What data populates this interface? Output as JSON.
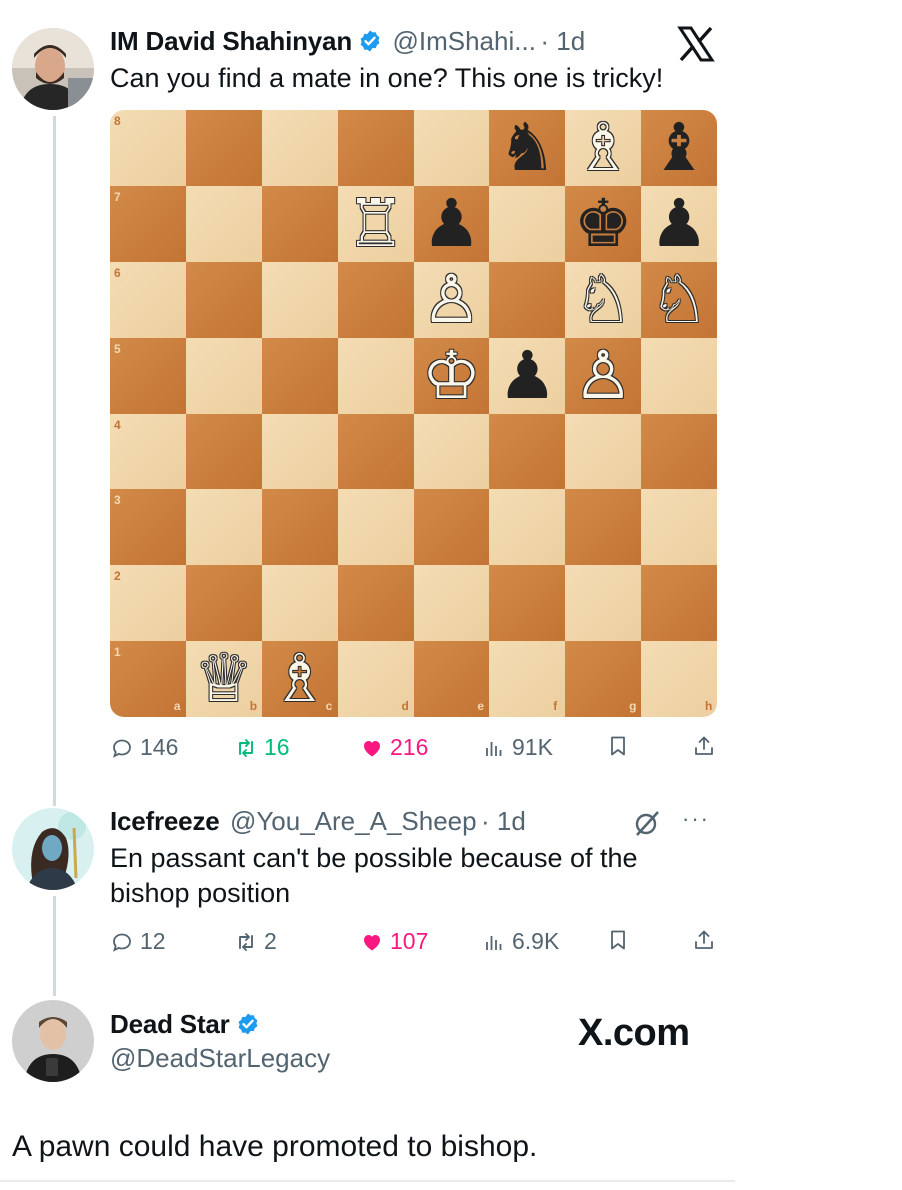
{
  "tweet1": {
    "name": "IM David Shahinyan",
    "handle": "@ImShahi...",
    "time": "· 1d",
    "text": "Can you find a mate in one? This one is tricky!",
    "replies": "146",
    "retweets": "16",
    "likes": "216",
    "views": "91K"
  },
  "board": {
    "ranks": [
      "8",
      "7",
      "6",
      "5",
      "4",
      "3",
      "2",
      "1"
    ],
    "files": [
      "a",
      "b",
      "c",
      "d",
      "e",
      "f",
      "g",
      "h"
    ],
    "pieces": [
      {
        "square": "f8",
        "glyph": "♞",
        "color": "black"
      },
      {
        "square": "g8",
        "glyph": "♗",
        "color": "white"
      },
      {
        "square": "h8",
        "glyph": "♝",
        "color": "black"
      },
      {
        "square": "d7",
        "glyph": "♖",
        "color": "white"
      },
      {
        "square": "e7",
        "glyph": "♟",
        "color": "black"
      },
      {
        "square": "g7",
        "glyph": "♚",
        "color": "black"
      },
      {
        "square": "h7",
        "glyph": "♟",
        "color": "black"
      },
      {
        "square": "e6",
        "glyph": "♙",
        "color": "white"
      },
      {
        "square": "g6",
        "glyph": "♘",
        "color": "white"
      },
      {
        "square": "h6",
        "glyph": "♘",
        "color": "white"
      },
      {
        "square": "e5",
        "glyph": "♔",
        "color": "white"
      },
      {
        "square": "f5",
        "glyph": "♟",
        "color": "black"
      },
      {
        "square": "g5",
        "glyph": "♙",
        "color": "white"
      },
      {
        "square": "b1",
        "glyph": "♕",
        "color": "white"
      },
      {
        "square": "c1",
        "glyph": "♗",
        "color": "white"
      }
    ],
    "colors": {
      "light": "#f0d9b5",
      "dark": "#c87a3c"
    }
  },
  "tweet2": {
    "name": "Icefreeze",
    "handle": "@You_Are_A_Sheep",
    "time": "· 1d",
    "text_line1": "En passant can't be possible because of the",
    "text_line2": "bishop position",
    "more": "···",
    "replies": "12",
    "retweets": "2",
    "likes": "107",
    "views": "6.9K"
  },
  "tweet3": {
    "name": "Dead Star",
    "handle": "@DeadStarLegacy",
    "watermark": "X.com",
    "text": "A pawn could have promoted to bishop."
  },
  "colors": {
    "retweet_active": "#00ba7c",
    "like_active": "#f91880",
    "verified": "#1d9bf0",
    "muted": "#536471"
  }
}
